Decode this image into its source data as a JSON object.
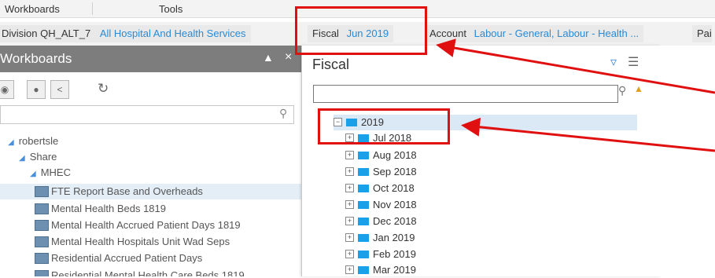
{
  "menubar": {
    "items": [
      "Workboards",
      "Tools"
    ]
  },
  "filterbar": {
    "division": {
      "label": "Division QH_ALT_7",
      "value": "All Hospital And Health Services"
    },
    "fiscal": {
      "label": "Fiscal",
      "value": "Jun 2019"
    },
    "account": {
      "label": "Account",
      "value": "Labour - General, Labour - Health ..."
    },
    "overflow_label": "Pai"
  },
  "workboards": {
    "title": "Workboards",
    "tree": [
      {
        "label": "robertsle"
      },
      {
        "label": "Share"
      },
      {
        "label": "MHEC"
      },
      {
        "label": "FTE Report Base and Overheads",
        "selected": true
      },
      {
        "label": "Mental Health Beds 1819"
      },
      {
        "label": "Mental Health  Accrued Patient Days 1819"
      },
      {
        "label": "Mental Health Hospitals Unit Wad Seps"
      },
      {
        "label": "Residential Accrued Patient Days"
      },
      {
        "label": "Residential Mental Health Care Beds 1819"
      }
    ]
  },
  "fiscal_panel": {
    "title": "Fiscal",
    "search_value": "",
    "root": "2019",
    "months": [
      "Jul 2018",
      "Aug 2018",
      "Sep 2018",
      "Oct 2018",
      "Nov 2018",
      "Dec 2018",
      "Jan 2019",
      "Feb 2019",
      "Mar 2019"
    ]
  },
  "colors": {
    "accent": "#2a8ad4",
    "annotation": "#e01010",
    "folder": "#1aa0e8",
    "header": "#7d7d7d"
  }
}
